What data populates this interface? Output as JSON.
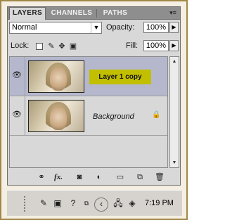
{
  "tabs": [
    {
      "label": "LAYERS",
      "active": true
    },
    {
      "label": "CHANNELS",
      "active": false
    },
    {
      "label": "PATHS",
      "active": false
    }
  ],
  "panel_menu_icon": "panel-menu-icon",
  "blend_mode": {
    "value": "Normal"
  },
  "opacity": {
    "label": "Opacity:",
    "value": "100%"
  },
  "lock": {
    "label": "Lock:",
    "icons": [
      "lock-transparent-icon",
      "lock-image-icon",
      "lock-position-icon",
      "lock-all-icon"
    ]
  },
  "fill": {
    "label": "Fill:",
    "value": "100%"
  },
  "layers": [
    {
      "name": "Layer 1 copy",
      "selected": true,
      "visible": true,
      "highlight_color": "#c2be00"
    },
    {
      "name": "Background",
      "selected": false,
      "visible": true,
      "locked": true
    }
  ],
  "bottom_icons": [
    "link-icon",
    "fx-icon",
    "mask-icon",
    "adjustment-icon",
    "group-folder-icon",
    "new-layer-icon",
    "trash-icon"
  ],
  "bottom_fx_label": "fx.",
  "taskbar": {
    "clock": "7:19 PM"
  },
  "colors": {
    "selected_layer": "#b5b8cc",
    "panel_bg": "#d8d8d8",
    "frame_border": "#a08848"
  }
}
